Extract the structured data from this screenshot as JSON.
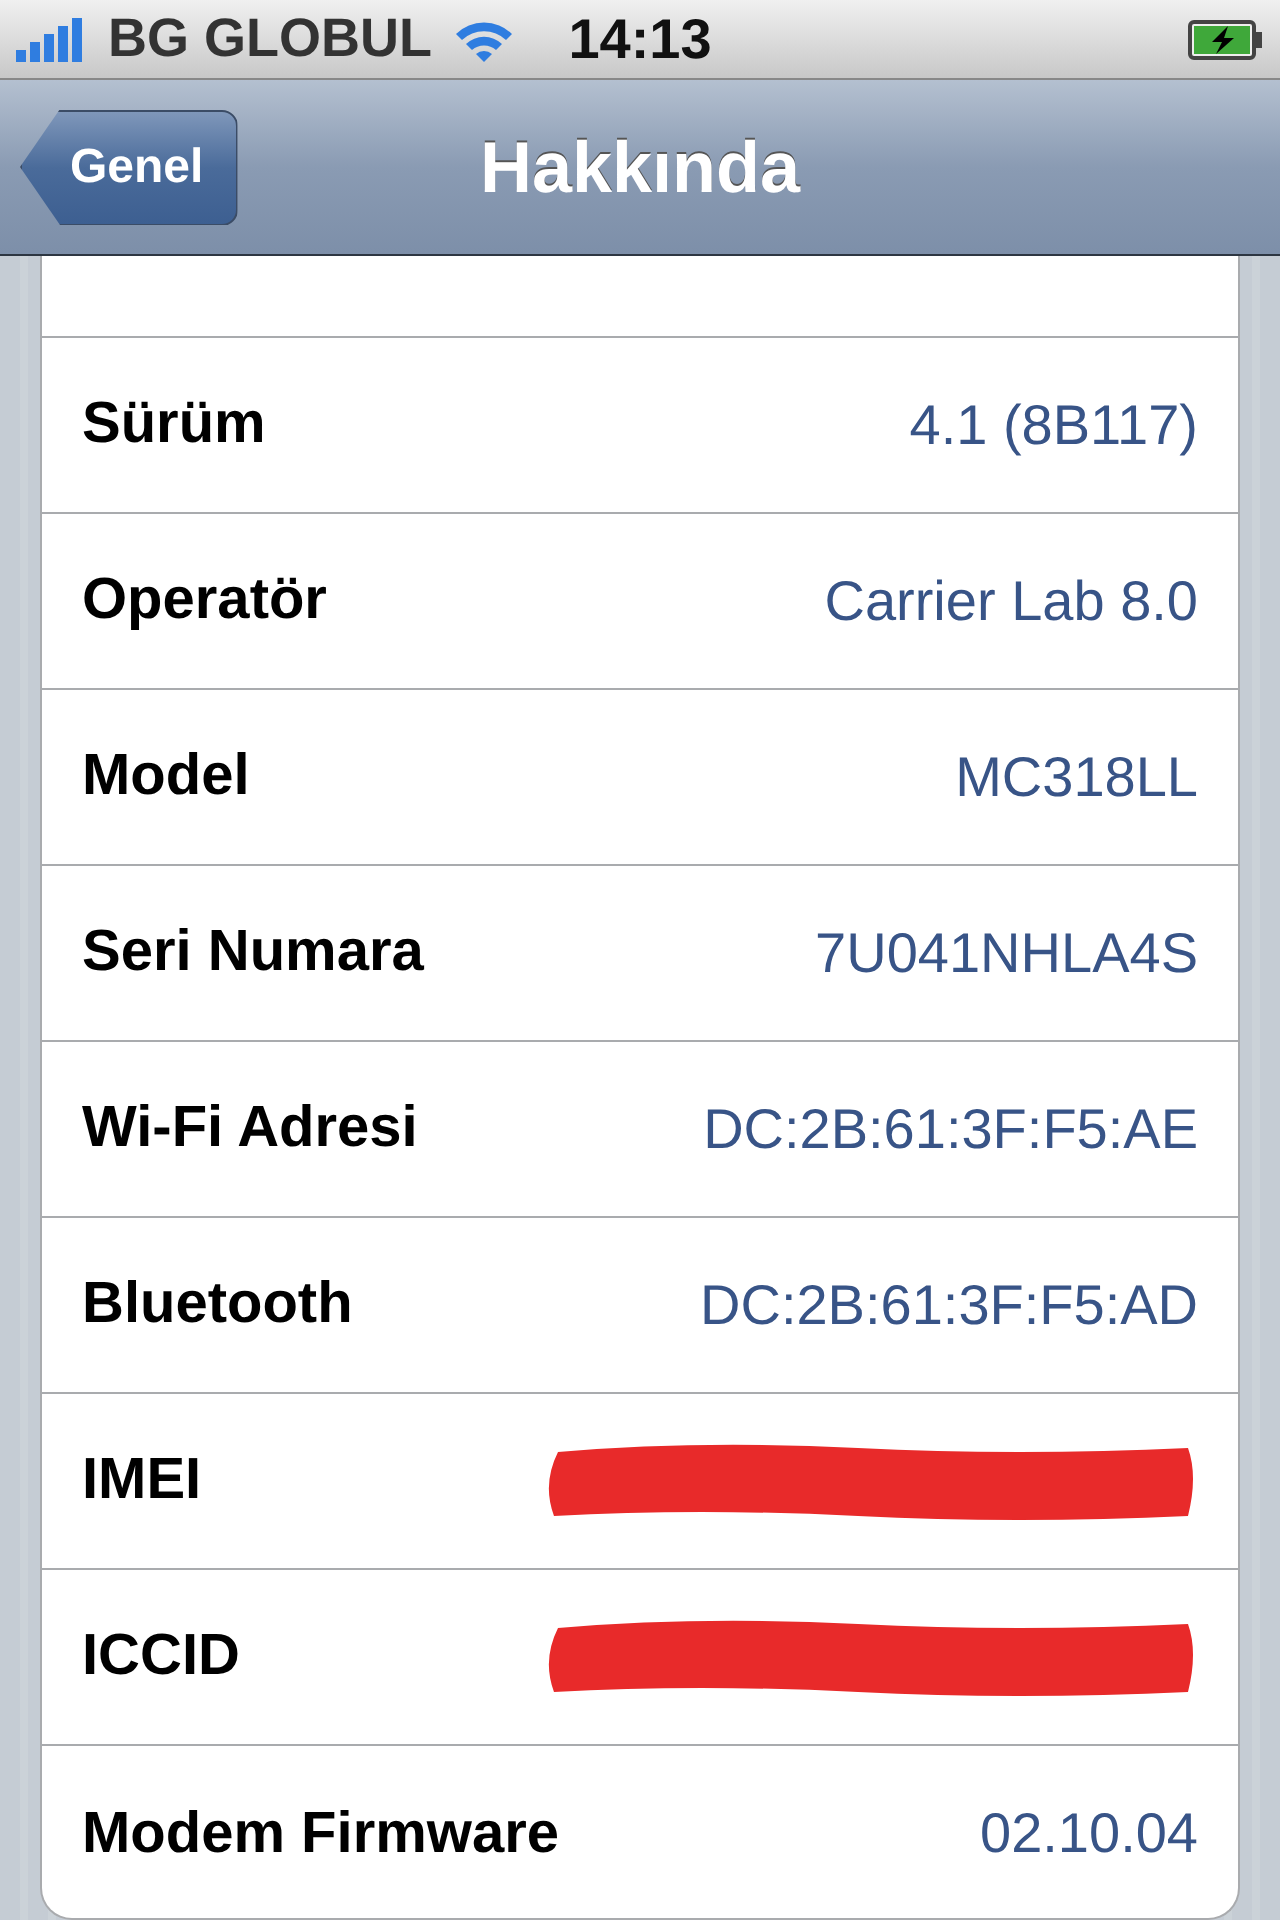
{
  "status_bar": {
    "carrier": "BG GLOBUL",
    "time": "14:13",
    "charging": true
  },
  "nav_bar": {
    "back": "Genel",
    "title": "Hakkında"
  },
  "rows": [
    {
      "kind": "text",
      "label": "Sürüm",
      "value": "4.1 (8B117)"
    },
    {
      "kind": "text",
      "label": "Operatör",
      "value": "Carrier Lab 8.0"
    },
    {
      "kind": "text",
      "label": "Model",
      "value": "MC318LL"
    },
    {
      "kind": "text",
      "label": "Seri Numara",
      "value": "7U041NHLA4S"
    },
    {
      "kind": "text",
      "label": "Wi-Fi Adresi",
      "value": "DC:2B:61:3F:F5:AE"
    },
    {
      "kind": "text",
      "label": "Bluetooth",
      "value": "DC:2B:61:3F:F5:AD"
    },
    {
      "kind": "redacted",
      "label": "IMEI"
    },
    {
      "kind": "redacted",
      "label": "ICCID"
    },
    {
      "kind": "text",
      "label": "Modem Firmware",
      "value": "02.10.04"
    }
  ]
}
